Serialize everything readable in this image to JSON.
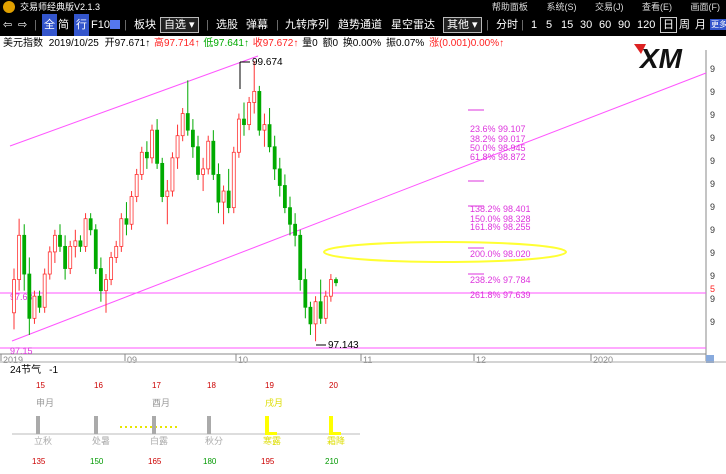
{
  "titlebar": {
    "app_title": "交易师经典版V2.1.3",
    "menus": [
      "帮助面板",
      "系统(S)",
      "交易(J)",
      "查看(E)",
      "画面(F)"
    ]
  },
  "toolbar": {
    "nav_back": "⇦",
    "nav_forward": "⇨",
    "btn_quan": "全",
    "btn_jian": "简",
    "btn_xing": "行",
    "btn_f10": "F10",
    "bankuai": "板块",
    "zixuan": "自选",
    "xuangu": "选股",
    "tanmu": "弹幕",
    "jiuzhuan": "九转序列",
    "qushi": "趋势通道",
    "xingkong": "星空雷达",
    "qita": "其他",
    "fenshi": "分时",
    "periods": [
      "1",
      "5",
      "15",
      "30",
      "60",
      "90",
      "120"
    ],
    "day": "日",
    "week": "周",
    "month": "月",
    "more": "更多"
  },
  "info": {
    "name": "美元指数",
    "date": "2019/10/25",
    "open": "开97.671↑",
    "high": "高97.714↑",
    "low": "低97.641↑",
    "close": "收97.672↑",
    "volume": "量0",
    "amount": "额0",
    "turnover": "换0.00%",
    "amplitude": "振0.07%",
    "change": "涨(0.001)0.00%↑"
  },
  "brand": {
    "logo_text": "XM"
  },
  "main_chart": {
    "annot_high": "99.674",
    "annot_low": "97.143",
    "left_label_pink": "97.63",
    "left_label_bottom": "97.15",
    "right_axis_labels": [
      "9",
      "9",
      "9",
      "9",
      "9",
      "9",
      "9",
      "9",
      "9",
      "9",
      "9",
      "9"
    ],
    "right_marker": "5",
    "x_labels": [
      "2019",
      "09",
      "10",
      "11",
      "12",
      "2020"
    ],
    "fib_levels": [
      "23.6% 99.107",
      "38.2% 99.017",
      "50.0% 98.945",
      "61.8% 98.872",
      "138.2% 98.401",
      "150.0% 98.328",
      "161.8% 98.255",
      "200.0% 98.020",
      "238.2% 97.784",
      "261.8% 97.639"
    ],
    "candles": [
      [
        97.4,
        97.8,
        97.25,
        97.7
      ],
      [
        97.7,
        98.25,
        97.6,
        98.1
      ],
      [
        98.1,
        98.2,
        97.6,
        97.75
      ],
      [
        97.75,
        97.9,
        97.2,
        97.35
      ],
      [
        97.35,
        97.6,
        97.3,
        97.55
      ],
      [
        97.55,
        97.6,
        97.4,
        97.45
      ],
      [
        97.45,
        97.8,
        97.4,
        97.75
      ],
      [
        97.75,
        98.0,
        97.7,
        97.95
      ],
      [
        97.95,
        98.15,
        97.85,
        98.1
      ],
      [
        98.1,
        98.2,
        97.95,
        98.0
      ],
      [
        98.0,
        98.1,
        97.7,
        97.8
      ],
      [
        97.8,
        98.05,
        97.75,
        98.0
      ],
      [
        98.0,
        98.15,
        97.9,
        98.05
      ],
      [
        98.05,
        98.1,
        97.95,
        98.0
      ],
      [
        98.0,
        98.3,
        97.95,
        98.25
      ],
      [
        98.25,
        98.3,
        98.1,
        98.15
      ],
      [
        98.15,
        98.2,
        97.75,
        97.8
      ],
      [
        97.8,
        97.9,
        97.5,
        97.6
      ],
      [
        97.6,
        97.75,
        97.4,
        97.7
      ],
      [
        97.7,
        97.95,
        97.65,
        97.9
      ],
      [
        97.9,
        98.05,
        97.85,
        98.0
      ],
      [
        98.0,
        98.3,
        97.95,
        98.25
      ],
      [
        98.25,
        98.4,
        98.1,
        98.2
      ],
      [
        98.2,
        98.5,
        98.15,
        98.45
      ],
      [
        98.45,
        98.7,
        98.4,
        98.65
      ],
      [
        98.65,
        98.9,
        98.6,
        98.85
      ],
      [
        98.85,
        98.95,
        98.7,
        98.8
      ],
      [
        98.8,
        99.1,
        98.75,
        99.05
      ],
      [
        99.05,
        99.15,
        98.7,
        98.75
      ],
      [
        98.75,
        98.8,
        98.4,
        98.45
      ],
      [
        98.45,
        98.6,
        98.2,
        98.5
      ],
      [
        98.5,
        98.85,
        98.45,
        98.8
      ],
      [
        98.8,
        99.1,
        98.7,
        99.0
      ],
      [
        99.0,
        99.25,
        98.95,
        99.2
      ],
      [
        99.2,
        99.5,
        99.0,
        99.05
      ],
      [
        99.05,
        99.15,
        98.8,
        98.9
      ],
      [
        98.9,
        99.0,
        98.6,
        98.65
      ],
      [
        98.65,
        98.8,
        98.5,
        98.7
      ],
      [
        98.7,
        99.0,
        98.65,
        98.95
      ],
      [
        98.95,
        99.05,
        98.6,
        98.65
      ],
      [
        98.65,
        98.75,
        98.3,
        98.4
      ],
      [
        98.4,
        98.55,
        98.2,
        98.5
      ],
      [
        98.5,
        98.7,
        98.3,
        98.35
      ],
      [
        98.35,
        98.9,
        98.3,
        98.85
      ],
      [
        98.85,
        99.2,
        98.8,
        99.15
      ],
      [
        99.15,
        99.3,
        99.0,
        99.1
      ],
      [
        99.1,
        99.35,
        99.05,
        99.3
      ],
      [
        99.3,
        99.674,
        99.2,
        99.4
      ],
      [
        99.4,
        99.45,
        99.0,
        99.05
      ],
      [
        99.05,
        99.2,
        98.9,
        99.1
      ],
      [
        99.1,
        99.25,
        98.85,
        98.9
      ],
      [
        98.9,
        99.0,
        98.6,
        98.7
      ],
      [
        98.7,
        98.8,
        98.45,
        98.55
      ],
      [
        98.55,
        98.65,
        98.3,
        98.35
      ],
      [
        98.35,
        98.45,
        98.1,
        98.2
      ],
      [
        98.2,
        98.3,
        98.0,
        98.1
      ],
      [
        98.1,
        98.15,
        97.6,
        97.7
      ],
      [
        97.7,
        97.8,
        97.35,
        97.45
      ],
      [
        97.45,
        97.5,
        97.2,
        97.3
      ],
      [
        97.3,
        97.55,
        97.143,
        97.5
      ],
      [
        97.5,
        97.7,
        97.3,
        97.35
      ],
      [
        97.35,
        97.6,
        97.3,
        97.55
      ],
      [
        97.55,
        97.75,
        97.5,
        97.7
      ],
      [
        97.7,
        97.72,
        97.64,
        97.672
      ]
    ]
  },
  "solar_panel": {
    "title": "24节气",
    "value": "-1",
    "top_numbers": [
      "15",
      "16",
      "17",
      "18",
      "19",
      "20"
    ],
    "months": [
      "申月",
      "酉月",
      "戌月"
    ],
    "terms": [
      "立秋",
      "处暑",
      "白露",
      "秋分",
      "寒露",
      "霜降"
    ],
    "bottom_numbers": [
      "135",
      "150",
      "165",
      "180",
      "195",
      "210"
    ]
  },
  "colors": {
    "up": "#ff3333",
    "down": "#00aa00",
    "channel": "#ff55ff",
    "fib": "#dd33dd",
    "ellipse": "#ffff33",
    "highlight": "#ffff00"
  }
}
